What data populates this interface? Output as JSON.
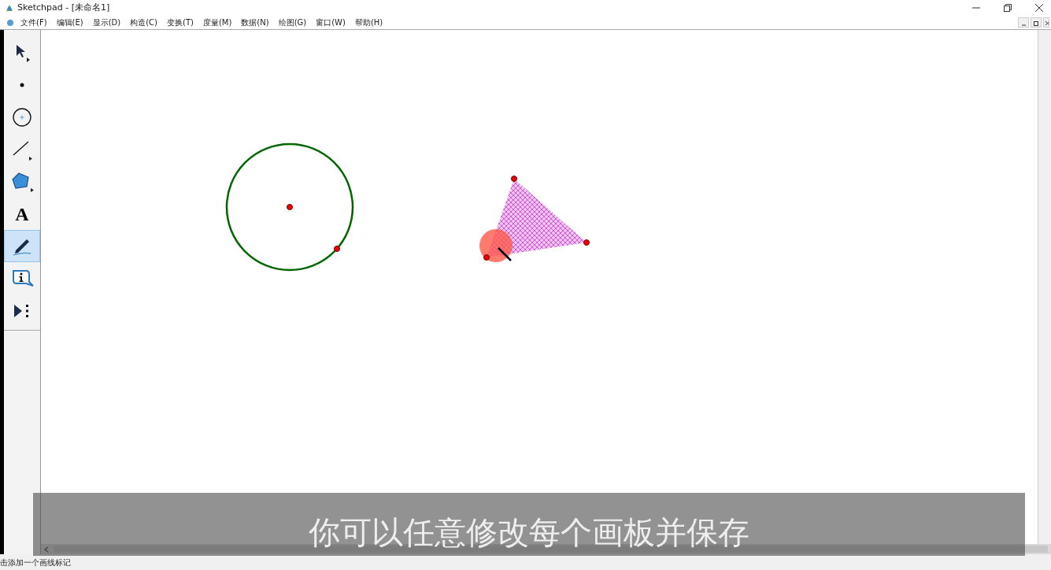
{
  "window": {
    "title": "Sketchpad  - [未命名1]"
  },
  "menu": [
    "文件(F)",
    "编辑(E)",
    "显示(D)",
    "构造(C)",
    "变换(T)",
    "度量(M)",
    "数据(N)",
    "绘图(G)",
    "窗口(W)",
    "帮助(H)"
  ],
  "tools": [
    {
      "kind": "arrow",
      "selected": false
    },
    {
      "kind": "point",
      "selected": false
    },
    {
      "kind": "compass",
      "selected": false
    },
    {
      "kind": "line",
      "selected": false
    },
    {
      "kind": "polygon",
      "selected": false
    },
    {
      "kind": "text",
      "label": "A",
      "selected": false
    },
    {
      "kind": "marker",
      "selected": true
    },
    {
      "kind": "info",
      "selected": false
    },
    {
      "kind": "custom",
      "selected": false
    }
  ],
  "status_bar": "击添加一个画线标记",
  "subtitle": "你可以任意修改每个画板并保存"
}
